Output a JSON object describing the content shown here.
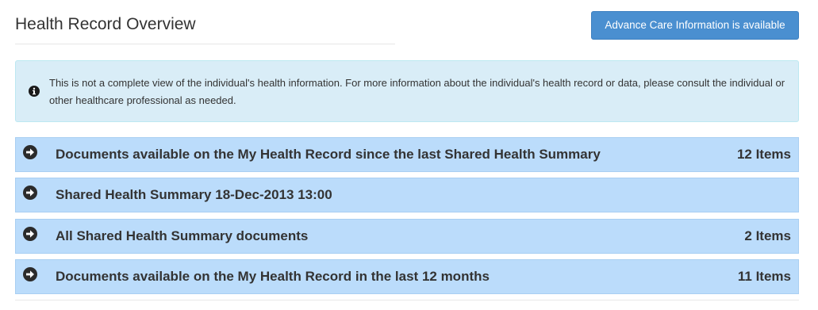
{
  "header": {
    "title": "Health Record Overview",
    "advance_care_button_label": "Advance Care Information is available"
  },
  "info_alert": {
    "icon": "info-circle-icon",
    "text": "This is not a complete view of the individual's health information. For more information about the individual's health record or data, please consult the individual or other healthcare professional as needed."
  },
  "accordion": {
    "icon": "arrow-circle-right-icon",
    "rows": [
      {
        "label": "Documents available on the My Health Record since the last Shared Health Summary",
        "count": "12 Items"
      },
      {
        "label": "Shared Health Summary 18-Dec-2013 13:00",
        "count": ""
      },
      {
        "label": "All Shared Health Summary documents",
        "count": "2 Items"
      },
      {
        "label": "Documents available on the My Health Record in the last 12 months",
        "count": "11 Items"
      }
    ]
  },
  "colors": {
    "button_blue": "#4a8fd0",
    "alert_background": "#d9edf7",
    "row_background": "#bbdcfb",
    "icon_dark": "#333333"
  }
}
